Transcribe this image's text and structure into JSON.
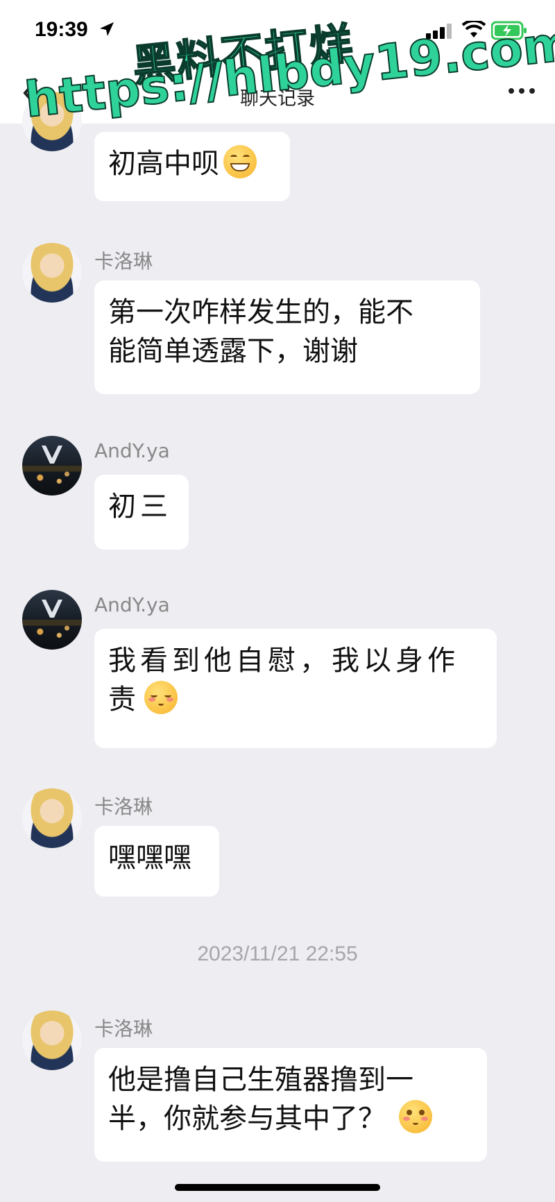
{
  "status_bar": {
    "time": "19:39",
    "icons": [
      "location-arrow-icon",
      "cellular-signal-icon",
      "wifi-icon",
      "battery-charging-icon"
    ],
    "battery_color": "#34c759"
  },
  "nav": {
    "title": "聊天记录",
    "back_icon": "chevron-left-icon",
    "more_icon": "more-dots-icon"
  },
  "watermark": {
    "line1": "黑料不打烊",
    "line2": "https://hlbdy19.com",
    "color": "#2fd39a"
  },
  "messages": [
    {
      "sender": "",
      "text": "初高中呗",
      "emoji": "grinning-face-icon",
      "avatar": "girl"
    },
    {
      "sender": "卡洛琳",
      "text_lines": [
        "第一次咋样发生的，能不",
        "能简单透露下，谢谢"
      ],
      "avatar": "girl"
    },
    {
      "sender": "AndY.ya",
      "text": "初三",
      "avatar": "city"
    },
    {
      "sender": "AndY.ya",
      "text_lines": [
        "我看到他自慰，我以身作",
        "责"
      ],
      "emoji": "blushing-face-icon",
      "avatar": "city"
    },
    {
      "sender": "卡洛琳",
      "text": "嘿嘿嘿",
      "avatar": "girl"
    },
    {
      "sender": "卡洛琳",
      "text_lines": [
        "他是撸自己生殖器撸到一",
        "半，你就参与其中了？"
      ],
      "emoji": "flushed-face-icon",
      "avatar": "girl"
    }
  ],
  "timestamp": "2023/11/21 22:55",
  "colors": {
    "background": "#ededf2",
    "bubble": "#ffffff",
    "sender_text": "#888888"
  }
}
